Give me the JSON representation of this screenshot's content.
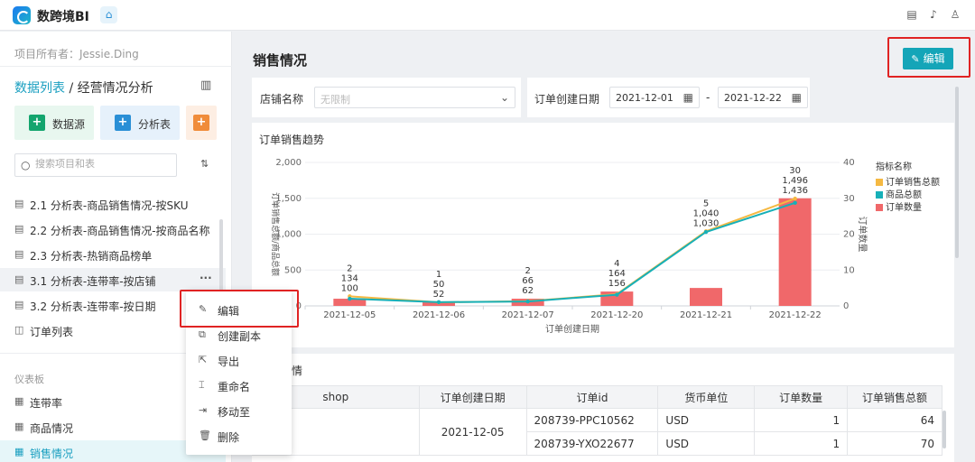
{
  "app": {
    "brand": "数跨境BI"
  },
  "sidebar": {
    "owner": "项目所有者：Jessie.Ding",
    "breadcrumb_link": "数据列表",
    "breadcrumb_sep": " / ",
    "breadcrumb_current": "经营情况分析",
    "tiles": [
      {
        "label": "数据源",
        "color": "#14a56e"
      },
      {
        "label": "分析表",
        "color": "#2a8fd6"
      },
      {
        "label": "",
        "color": "#f08c3a"
      }
    ],
    "search_placeholder": "搜索项目和表",
    "items": [
      {
        "label": "2.1 分析表-商品销售情况-按SKU"
      },
      {
        "label": "2.2 分析表-商品销售情况-按商品名称"
      },
      {
        "label": "2.3 分析表-热销商品榜单"
      },
      {
        "label": "3.1 分析表-连带率-按店铺"
      },
      {
        "label": "3.2 分析表-连带率-按日期"
      },
      {
        "label": "订单列表"
      }
    ],
    "section_dashboards": "仪表板",
    "dashboards": [
      {
        "label": "连带率"
      },
      {
        "label": "商品情况"
      },
      {
        "label": "销售情况"
      }
    ]
  },
  "context_menu": {
    "items": [
      {
        "label": "编辑"
      },
      {
        "label": "创建副本"
      },
      {
        "label": "导出"
      },
      {
        "label": "重命名"
      },
      {
        "label": "移动至"
      },
      {
        "label": "删除"
      }
    ]
  },
  "main": {
    "title": "销售情况",
    "edit_label": "编辑",
    "filters": {
      "store_label": "店铺名称",
      "store_placeholder": "无限制",
      "date_label": "订单创建日期",
      "date_start": "2021-12-01",
      "date_sep": "-",
      "date_end": "2021-12-22"
    },
    "chart_card_title": "订单销售趋势",
    "table_card_title": "销售详情",
    "table": {
      "headers": [
        "shop",
        "订单创建日期",
        "订单id",
        "货币单位",
        "订单数量",
        "订单销售总额"
      ],
      "date_cell": "2021-12-05",
      "rows": [
        {
          "order_id": "208739-PPC10562",
          "currency": "USD",
          "qty": "1",
          "total": "64"
        },
        {
          "order_id": "208739-YXO22677",
          "currency": "USD",
          "qty": "1",
          "total": "70"
        }
      ]
    }
  },
  "chart_data": {
    "type": "bar",
    "categories": [
      "2021-12-05",
      "2021-12-06",
      "2021-12-07",
      "2021-12-20",
      "2021-12-21",
      "2021-12-22"
    ],
    "xlabel": "订单创建日期",
    "ylabel_left": "订单销售总额/商品总额",
    "ylabel_right": "订单数量",
    "ylim_left": [
      0,
      2000
    ],
    "ylim_right": [
      0,
      40
    ],
    "yticks_left": [
      "0",
      "500",
      "1,000",
      "1,500",
      "2,000"
    ],
    "yticks_right": [
      "0",
      "10",
      "20",
      "30",
      "40"
    ],
    "legend_title": "指标名称",
    "series": [
      {
        "name": "订单销售总额",
        "kind": "line",
        "axis": "left",
        "color": "#f5b942",
        "values": [
          134,
          50,
          66,
          164,
          1040,
          1496
        ],
        "labels": [
          "134",
          "50",
          "66",
          "164",
          "1,040",
          "1,496"
        ]
      },
      {
        "name": "商品总额",
        "kind": "line",
        "axis": "left",
        "color": "#17b0b8",
        "values": [
          100,
          52,
          62,
          156,
          1030,
          1436
        ],
        "labels": [
          "100",
          "52",
          "62",
          "156",
          "1,030",
          "1,436"
        ]
      },
      {
        "name": "订单数量",
        "kind": "bar",
        "axis": "right",
        "color": "#f0686a",
        "values": [
          2,
          1,
          2,
          4,
          5,
          30
        ],
        "labels": [
          "2",
          "1",
          "2",
          "4",
          "5",
          "30"
        ]
      }
    ]
  }
}
